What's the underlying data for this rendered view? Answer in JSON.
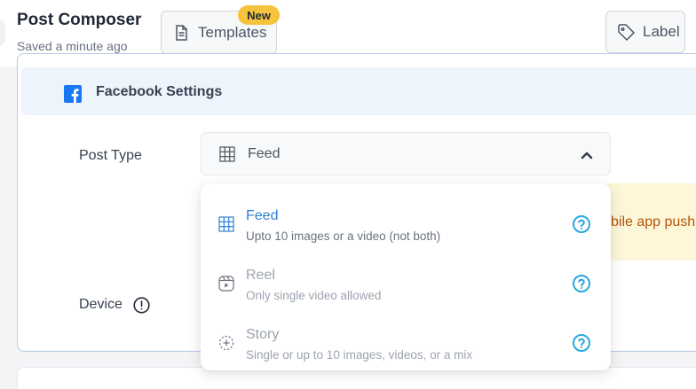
{
  "header": {
    "title": "Post Composer",
    "subtitle": "Saved a minute ago",
    "templates_label": "Templates",
    "new_badge": "New",
    "label_button": "Label"
  },
  "facebook_settings": {
    "title": "Facebook Settings"
  },
  "form": {
    "post_type_label": "Post Type",
    "device_label": "Device",
    "post_type_selected": "Feed"
  },
  "notice": {
    "partial_text": "bile app push"
  },
  "dropdown": {
    "options": [
      {
        "title": "Feed",
        "description": "Upto 10 images or a video (not both)",
        "icon": "grid-icon",
        "selected": true
      },
      {
        "title": "Reel",
        "description": "Only single video allowed",
        "icon": "reel-icon",
        "selected": false
      },
      {
        "title": "Story",
        "description": "Single or up to 10 images, videos, or a mix",
        "icon": "story-icon",
        "selected": false
      }
    ]
  },
  "colors": {
    "accent_blue": "#2f80d1",
    "help_icon": "#29a8e0",
    "badge_yellow": "#f6c33c",
    "facebook_blue": "#1877f2",
    "notice_bg": "#fdf6d8",
    "notice_text": "#b45309"
  }
}
